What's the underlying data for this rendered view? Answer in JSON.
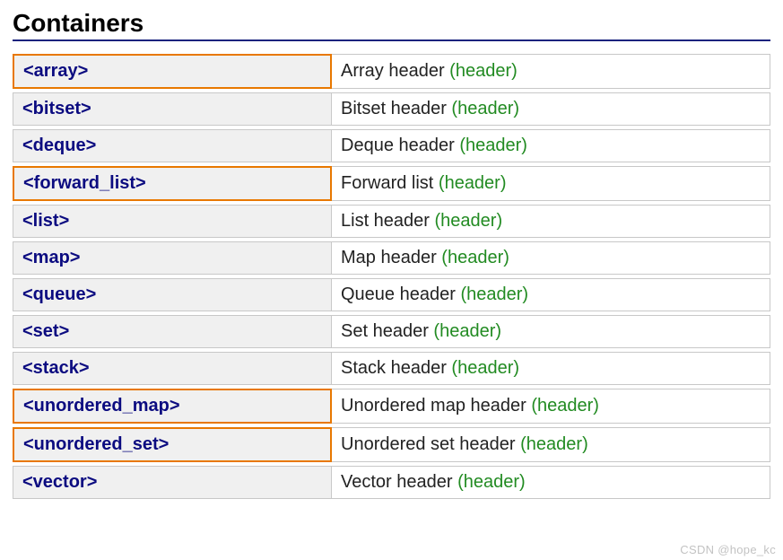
{
  "title": "Containers",
  "type_label": "(header)",
  "rows": [
    {
      "name": "<array>",
      "desc": "Array header ",
      "highlighted": true
    },
    {
      "name": "<bitset>",
      "desc": "Bitset header ",
      "highlighted": false
    },
    {
      "name": "<deque>",
      "desc": "Deque header ",
      "highlighted": false
    },
    {
      "name": "<forward_list>",
      "desc": "Forward list ",
      "highlighted": true
    },
    {
      "name": "<list>",
      "desc": "List header ",
      "highlighted": false
    },
    {
      "name": "<map>",
      "desc": "Map header ",
      "highlighted": false
    },
    {
      "name": "<queue>",
      "desc": "Queue header ",
      "highlighted": false
    },
    {
      "name": "<set>",
      "desc": "Set header ",
      "highlighted": false
    },
    {
      "name": "<stack>",
      "desc": "Stack header ",
      "highlighted": false
    },
    {
      "name": "<unordered_map>",
      "desc": "Unordered map header ",
      "highlighted": true
    },
    {
      "name": "<unordered_set>",
      "desc": "Unordered set header ",
      "highlighted": true
    },
    {
      "name": "<vector>",
      "desc": "Vector header ",
      "highlighted": false
    }
  ],
  "watermark": "CSDN @hope_kc"
}
